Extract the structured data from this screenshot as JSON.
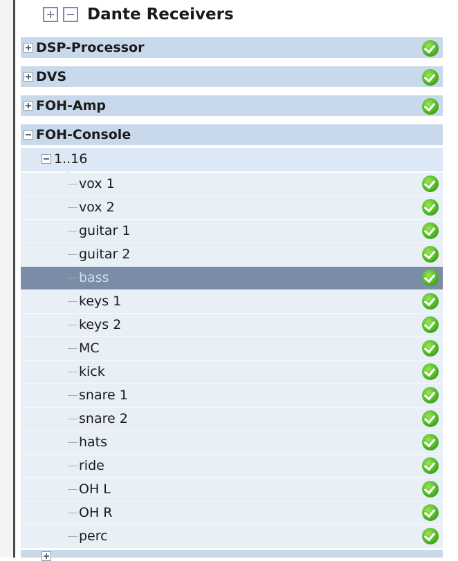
{
  "header": {
    "title": "Dante Receivers"
  },
  "devices": [
    {
      "label": "DSP-Processor",
      "expanded": false,
      "status": "check-icon"
    },
    {
      "label": "DVS",
      "expanded": false,
      "status": "check-icon"
    },
    {
      "label": "FOH-Amp",
      "expanded": false,
      "status": "check-icon"
    },
    {
      "label": "FOH-Console",
      "expanded": true
    }
  ],
  "group": {
    "label": "1..16",
    "expanded": true
  },
  "channels": [
    {
      "label": "vox 1",
      "selected": false
    },
    {
      "label": "vox 2",
      "selected": false
    },
    {
      "label": "guitar 1",
      "selected": false
    },
    {
      "label": "guitar 2",
      "selected": false
    },
    {
      "label": "bass",
      "selected": true
    },
    {
      "label": "keys 1",
      "selected": false
    },
    {
      "label": "keys 2",
      "selected": false
    },
    {
      "label": "MC",
      "selected": false
    },
    {
      "label": "kick",
      "selected": false
    },
    {
      "label": "snare 1",
      "selected": false
    },
    {
      "label": "snare 2",
      "selected": false
    },
    {
      "label": "hats",
      "selected": false
    },
    {
      "label": "ride",
      "selected": false
    },
    {
      "label": "OH L",
      "selected": false
    },
    {
      "label": "OH R",
      "selected": false
    },
    {
      "label": "perc",
      "selected": false
    }
  ],
  "colors": {
    "row": "#c9d9ec",
    "selected": "#7b8ca6",
    "status_ok": "#4fb826"
  }
}
